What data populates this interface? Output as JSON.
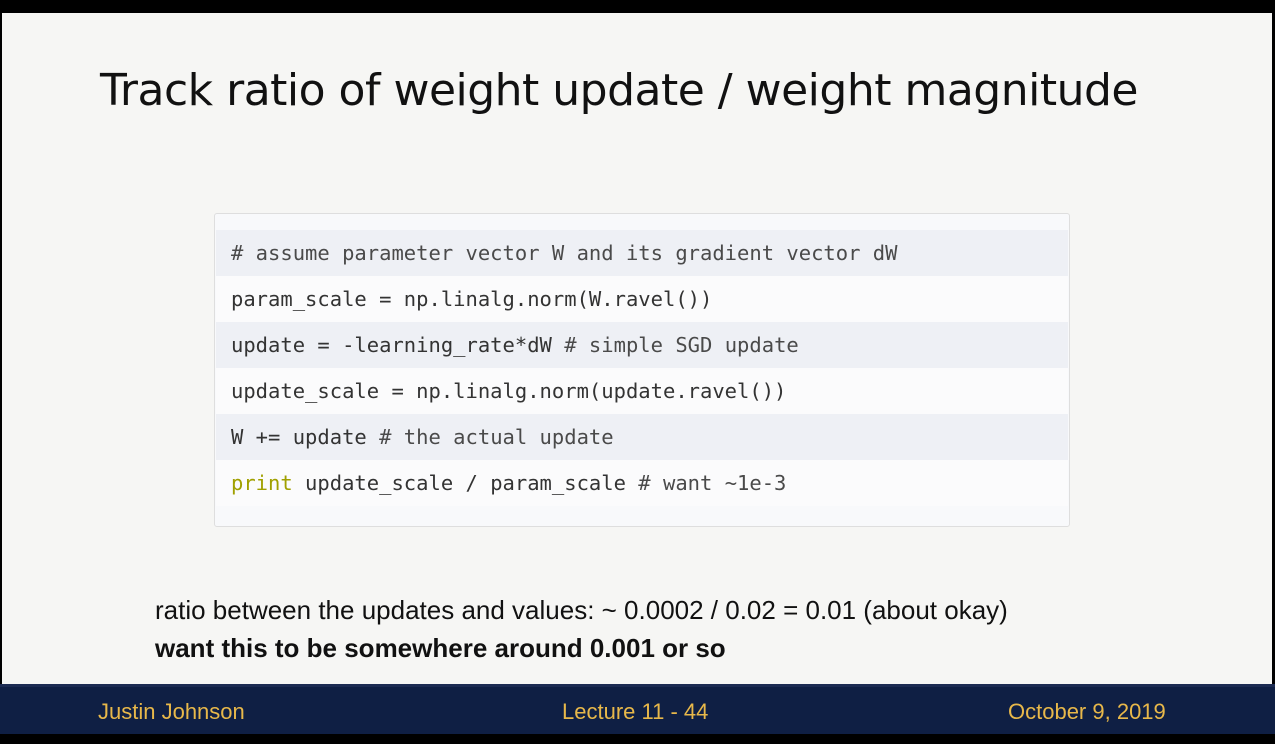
{
  "slide": {
    "title": "Track ratio of weight update / weight magnitude",
    "code": {
      "line1": "# assume parameter vector W and its gradient vector dW",
      "line2": "param_scale = np.linalg.norm(W.ravel())",
      "line3_code": "update = -learning_rate*dW ",
      "line3_comment": "# simple SGD update",
      "line4": "update_scale = np.linalg.norm(update.ravel())",
      "line5_code": "W += update ",
      "line5_comment": "# the actual update",
      "line6_keyword": "print",
      "line6_code": " update_scale / param_scale ",
      "line6_comment": "# want ~1e-3"
    },
    "body": {
      "ratio_text": "ratio between the updates and values: ~ 0.0002 / 0.02 = 0.01 (about okay)",
      "want_text": "want this to be somewhere around 0.001 or so"
    }
  },
  "footer": {
    "author": "Justin Johnson",
    "lecture": "Lecture 11 - 44",
    "date": "October 9, 2019"
  },
  "colors": {
    "footer_bg": "#0f1f44",
    "footer_text": "#e8b84a",
    "keyword": "#a0a000"
  }
}
